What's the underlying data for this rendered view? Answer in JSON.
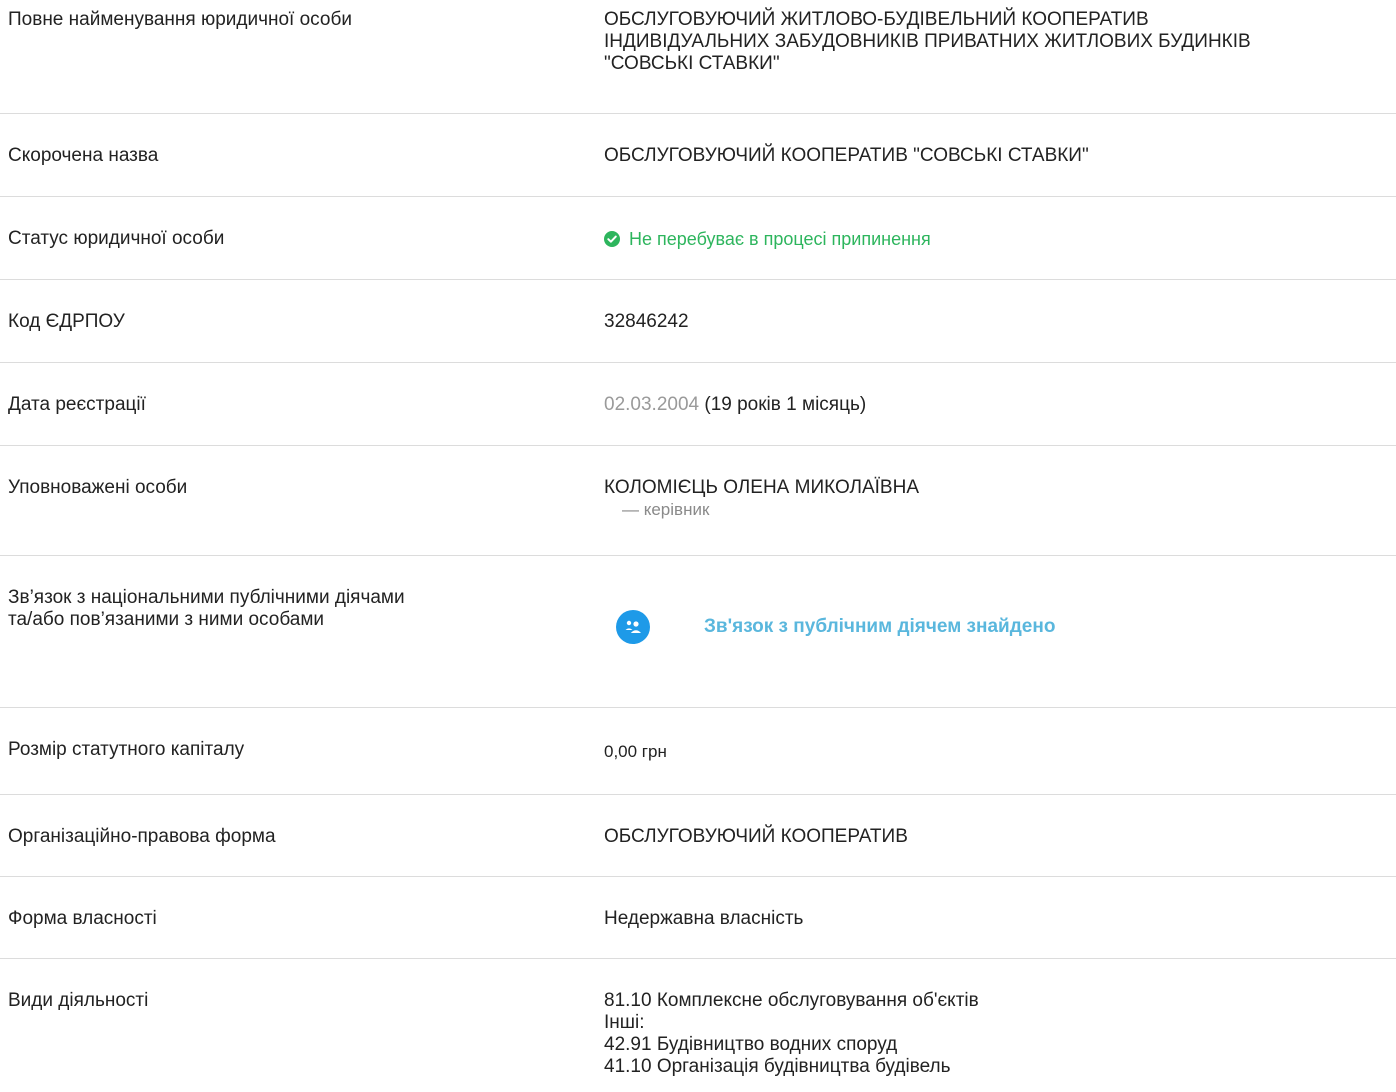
{
  "rows": {
    "full_name": {
      "label": "Повне найменування юридичної особи",
      "line1": "ОБСЛУГОВУЮЧИЙ ЖИТЛОВО-БУДІВЕЛЬНИЙ КООПЕРАТИВ",
      "line2": "ІНДИВІДУАЛЬНИХ ЗАБУДОВНИКІВ ПРИВАТНИХ ЖИТЛОВИХ БУДИНКІВ",
      "line3": "\"СОВСЬКІ СТАВКИ\""
    },
    "short_name": {
      "label": "Скорочена назва",
      "value": "ОБСЛУГОВУЮЧИЙ КООПЕРАТИВ \"СОВСЬКІ СТАВКИ\""
    },
    "status": {
      "label": "Статус юридичної особи",
      "value": "Не перебуває в процесі припинення",
      "icon": "check-circle-icon",
      "color": "#2db55d"
    },
    "edrpou": {
      "label": "Код ЄДРПОУ",
      "value": "32846242"
    },
    "registration_date": {
      "label": "Дата реєстрації",
      "date": "02.03.2004",
      "age": "(19 років 1 місяць)"
    },
    "authorized": {
      "label": "Уповноважені особи",
      "name": "КОЛОМІЄЦЬ ОЛЕНА МИКОЛАЇВНА",
      "role": "— керівник"
    },
    "pep": {
      "label_line1": "Зв’язок з національними публічними діячами",
      "label_line2": "та/або пов’язаними з ними особами",
      "link": "Зв'язок з публічним діячем знайдено",
      "icon": "people-icon",
      "icon_color": "#1e9ae8",
      "link_color": "#5ab7dd"
    },
    "capital": {
      "label": "Розмір статутного капіталу",
      "value": "0,00 грн"
    },
    "legal_form": {
      "label": "Організаційно-правова форма",
      "value": "ОБСЛУГОВУЮЧИЙ КООПЕРАТИВ"
    },
    "ownership": {
      "label": "Форма власності",
      "value": "Недержавна власність"
    },
    "activities": {
      "label": "Види діяльності",
      "main": "81.10 Комплексне обслуговування об'єктів",
      "others_label": "Інші:",
      "others": [
        "42.91 Будівництво водних споруд",
        "41.10 Організація будівництва будівель"
      ]
    }
  }
}
